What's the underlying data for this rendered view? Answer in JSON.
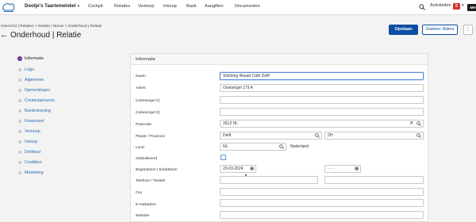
{
  "topbar": {
    "company": "Dootje's Taartenwinkel",
    "nav": [
      "Cockpit",
      "Relaties",
      "Verkoop",
      "Inkoop",
      "Bank",
      "Aangiften",
      "Documenten"
    ],
    "activities_label": "Activiteiten",
    "activities_count": "5",
    "avatar": "MH"
  },
  "header": {
    "breadcrumb": "Overzicht | Relaties > Relatie | Nieuw > Onderhoud | Relatie",
    "title": "Onderhoud | Relatie",
    "save_label": "Opslaan",
    "search_label": "Zoeken: Adres",
    "more_label": "⋮"
  },
  "sidebar": {
    "items": [
      {
        "label": "Informatie",
        "active": true
      },
      {
        "label": "Logo"
      },
      {
        "label": "Algemeen"
      },
      {
        "label": "Opmerkingen"
      },
      {
        "label": "Contactpersoon"
      },
      {
        "label": "Bankrekening"
      },
      {
        "label": "Financieel"
      },
      {
        "label": "Verkoop"
      },
      {
        "label": "Inkoop"
      },
      {
        "label": "Debiteur"
      },
      {
        "label": "Crediteur"
      },
      {
        "label": "Marketing"
      }
    ]
  },
  "form": {
    "section_title": "Informatie",
    "labels": {
      "naam": "Naam",
      "adres": "Adres",
      "adresregel2": "(Adresregel 2)",
      "adresregel3": "(Adresregel 3)",
      "postcode": "Postcode",
      "plaats": "Plaats / Provincie",
      "land": "Land",
      "geblokkeerd": "Geblokkeerd",
      "datum": "Begindatum / Einddatum",
      "telefoon": "Telefoon / Toestel",
      "fax": "Fax",
      "email": "E-mailadres",
      "website": "Website"
    },
    "values": {
      "naam": "Stichting Repair Café Delft",
      "adres": "Oostsingel 179 A",
      "adresregel2": "",
      "adresregel3": "",
      "postcode": "2612 HL",
      "plaats": "Delft",
      "provincie": "ZH",
      "land_code": "NL",
      "land_name": "Nederland",
      "begindatum": "20-03-2024",
      "einddatum": "- - -",
      "telefoon": "",
      "toestel": "",
      "fax": "",
      "email": "",
      "website": ""
    }
  }
}
